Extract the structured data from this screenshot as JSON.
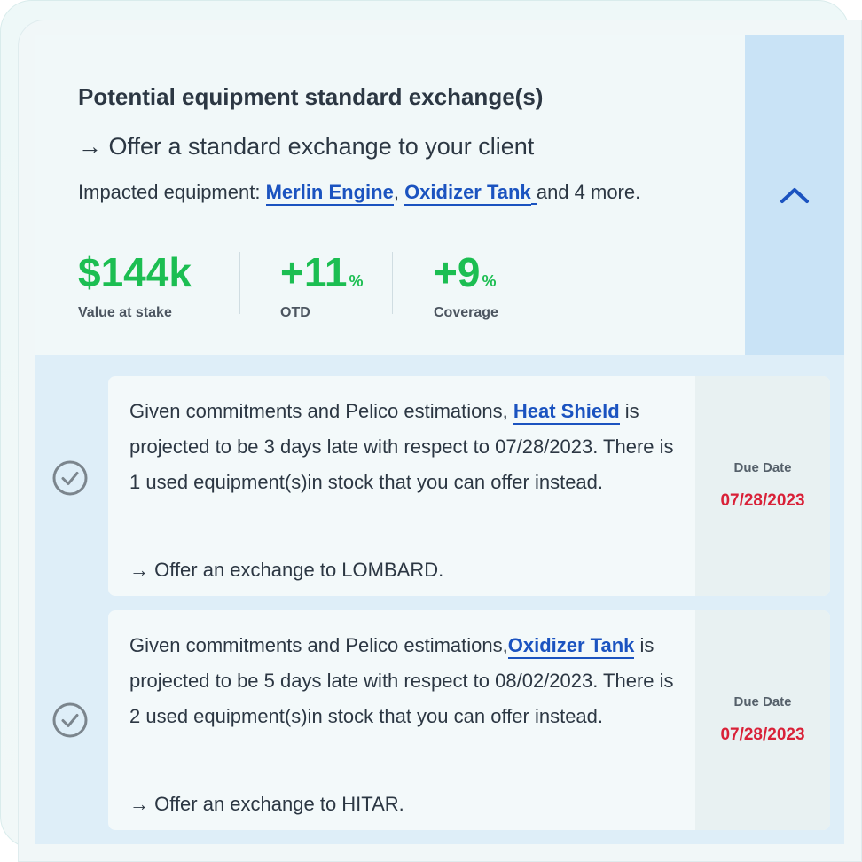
{
  "header": {
    "title": "Potential equipment standard exchange(s)",
    "subtitle": "→ Offer a standard exchange to your client",
    "impacted_prefix": "Impacted equipment: ",
    "impacted_links": [
      "Merlin Engine",
      "Oxidizer Tank"
    ],
    "impacted_separator": ", ",
    "impacted_suffix": "and 4 more.",
    "collapse_icon": "chevron-up-icon"
  },
  "metrics": [
    {
      "value": "$144k",
      "unit": "",
      "label": "Value at stake"
    },
    {
      "value": "+11",
      "unit": "%",
      "label": "OTD"
    },
    {
      "value": "+9",
      "unit": "%",
      "label": "Coverage"
    }
  ],
  "items": [
    {
      "text_before": "Given commitments and Pelico estimations, ",
      "link": "Heat Shield",
      "text_after": " is projected to be 3 days late with respect to 07/28/2023. There is 1 used equipment(s)in stock that you can offer instead.",
      "action": "→ Offer an exchange to LOMBARD.",
      "due_label": "Due Date",
      "due_value": "07/28/2023"
    },
    {
      "text_before": "Given commitments and Pelico estimations,",
      "link": "Oxidizer Tank",
      "text_after": " is projected to be 5 days late with respect to 08/02/2023. There is 2 used equipment(s)in stock that you can offer instead.",
      "action": "→ Offer an exchange to HITAR.",
      "due_label": "Due Date",
      "due_value": "07/28/2023"
    }
  ],
  "colors": {
    "accent_blue": "#1b53c0",
    "positive_green": "#1cbe52",
    "due_red": "#d92138"
  }
}
